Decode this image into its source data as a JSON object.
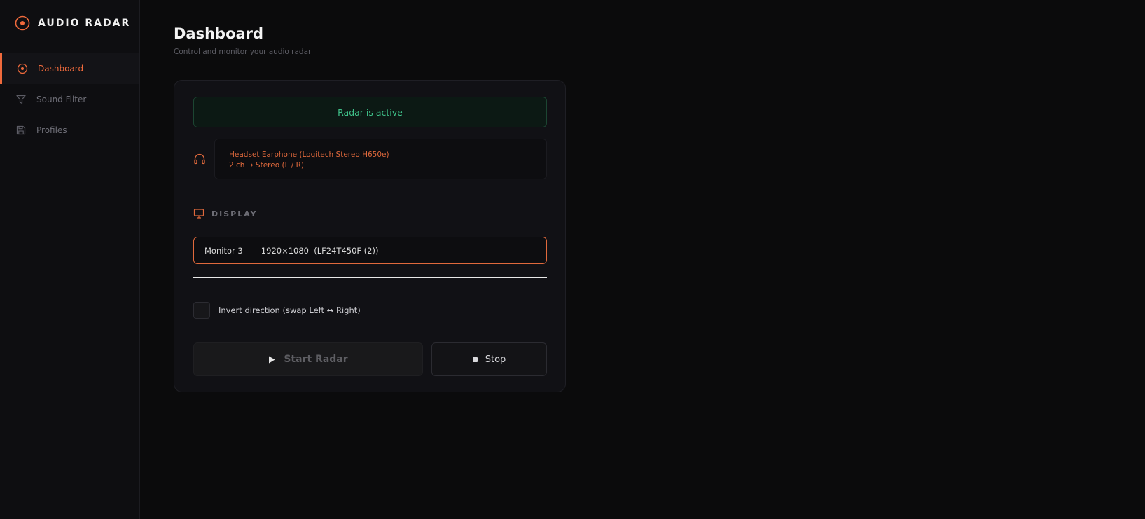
{
  "app": {
    "brand": "AUDIO RADAR",
    "accent_color": "#f06a3c",
    "success_color": "#3fc28a"
  },
  "sidebar": {
    "items": [
      {
        "label": "Dashboard",
        "icon": "radar-icon",
        "active": true
      },
      {
        "label": "Sound Filter",
        "icon": "filter-icon",
        "active": false
      },
      {
        "label": "Profiles",
        "icon": "save-icon",
        "active": false
      }
    ]
  },
  "main": {
    "title": "Dashboard",
    "subtitle": "Control and monitor your audio radar",
    "status": "Radar is active",
    "device": {
      "name": "Headset Earphone (Logitech Stereo H650e)",
      "channels": "2 ch  →  Stereo (L / R)",
      "icon": "headphones-icon"
    },
    "display": {
      "label": "DISPLAY",
      "icon": "monitor-icon",
      "selected": "Monitor 3  —  1920×1080  (LF24T450F (2))"
    },
    "invert": {
      "label": "Invert direction (swap Left ↔ Right)",
      "checked": false
    },
    "buttons": {
      "start": "Start Radar",
      "stop": "Stop"
    }
  }
}
